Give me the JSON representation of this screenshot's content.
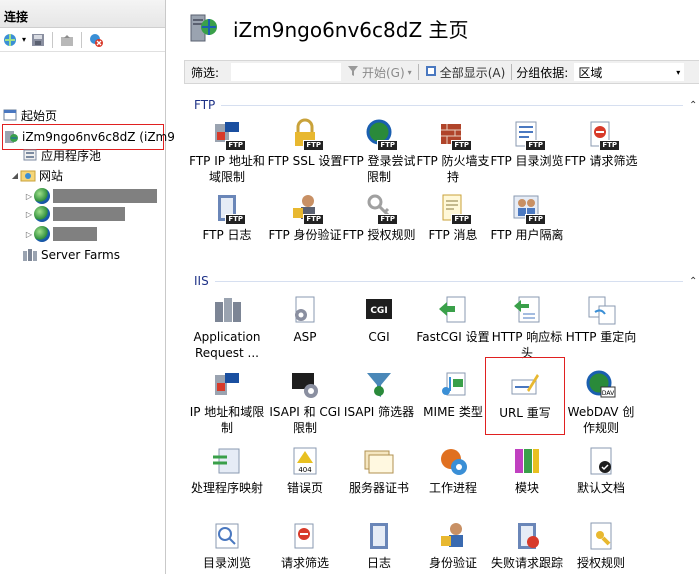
{
  "left_pane": {
    "title": "连接",
    "tree": {
      "start_page": "起始页",
      "server": "iZm9ngo6nv6c8dZ (iZm9",
      "app_pools": "应用程序池",
      "sites": "网站",
      "site_children": [
        "",
        "",
        ""
      ],
      "server_farms": "Server Farms"
    }
  },
  "header": {
    "title": "iZm9ngo6nv6c8dZ 主页"
  },
  "filter_bar": {
    "filter_label": "筛选:",
    "filter_value": "",
    "start_label": "开始(G)",
    "show_all_label": "全部显示(A)",
    "group_by_label": "分组依据:",
    "group_by_value": "区域"
  },
  "sections": {
    "ftp": {
      "name": "FTP",
      "features": [
        {
          "label": "FTP IP 地址和域限制",
          "icon": "ftp-ip-restriction-icon"
        },
        {
          "label": "FTP SSL 设置",
          "icon": "ftp-ssl-lock-icon"
        },
        {
          "label": "FTP 登录尝试限制",
          "icon": "ftp-logon-globe-icon"
        },
        {
          "label": "FTP 防火墙支持",
          "icon": "ftp-firewall-brick-icon"
        },
        {
          "label": "FTP 目录浏览",
          "icon": "ftp-directory-browse-icon"
        },
        {
          "label": "FTP 请求筛选",
          "icon": "ftp-request-filter-icon"
        },
        {
          "label": "FTP 日志",
          "icon": "ftp-log-notebook-icon"
        },
        {
          "label": "FTP 身份验证",
          "icon": "ftp-authentication-user-icon"
        },
        {
          "label": "FTP 授权规则",
          "icon": "ftp-authorization-key-icon"
        },
        {
          "label": "FTP 消息",
          "icon": "ftp-message-document-icon"
        },
        {
          "label": "FTP 用户隔离",
          "icon": "ftp-user-isolation-icon"
        }
      ]
    },
    "iis": {
      "name": "IIS",
      "features": [
        {
          "label": "Application Request ...",
          "icon": "arr-server-icon"
        },
        {
          "label": "ASP",
          "icon": "asp-gear-page-icon"
        },
        {
          "label": "CGI",
          "icon": "cgi-icon"
        },
        {
          "label": "FastCGI 设置",
          "icon": "fastcgi-arrow-page-icon"
        },
        {
          "label": "HTTP 响应标头",
          "icon": "http-response-headers-icon"
        },
        {
          "label": "HTTP 重定向",
          "icon": "http-redirect-icon"
        },
        {
          "label": "IP 地址和域限制",
          "icon": "ip-domain-restriction-icon"
        },
        {
          "label": "ISAPI 和 CGI 限制",
          "icon": "isapi-cgi-restriction-icon"
        },
        {
          "label": "ISAPI 筛选器",
          "icon": "isapi-filter-funnel-icon"
        },
        {
          "label": "MIME 类型",
          "icon": "mime-types-icon"
        },
        {
          "label": "URL 重写",
          "icon": "url-rewrite-pencil-icon"
        },
        {
          "label": "WebDAV 创作规则",
          "icon": "webdav-globe-icon"
        },
        {
          "label": "处理程序映射",
          "icon": "handler-mappings-icon"
        },
        {
          "label": "错误页",
          "icon": "error-pages-warning-icon"
        },
        {
          "label": "服务器证书",
          "icon": "server-certificates-icon"
        },
        {
          "label": "工作进程",
          "icon": "worker-processes-icon"
        },
        {
          "label": "模块",
          "icon": "modules-icon"
        },
        {
          "label": "默认文档",
          "icon": "default-document-icon"
        },
        {
          "label": "目录浏览",
          "icon": "directory-browsing-icon"
        },
        {
          "label": "请求筛选",
          "icon": "request-filtering-icon"
        },
        {
          "label": "日志",
          "icon": "logging-notebook-icon"
        },
        {
          "label": "身份验证",
          "icon": "authentication-user-icon"
        },
        {
          "label": "失败请求跟踪",
          "icon": "failed-request-tracing-icon"
        },
        {
          "label": "授权规则",
          "icon": "authorization-rules-icon"
        }
      ]
    }
  },
  "colors": {
    "section_title": "#1e3287",
    "highlight_border": "#e02020"
  }
}
